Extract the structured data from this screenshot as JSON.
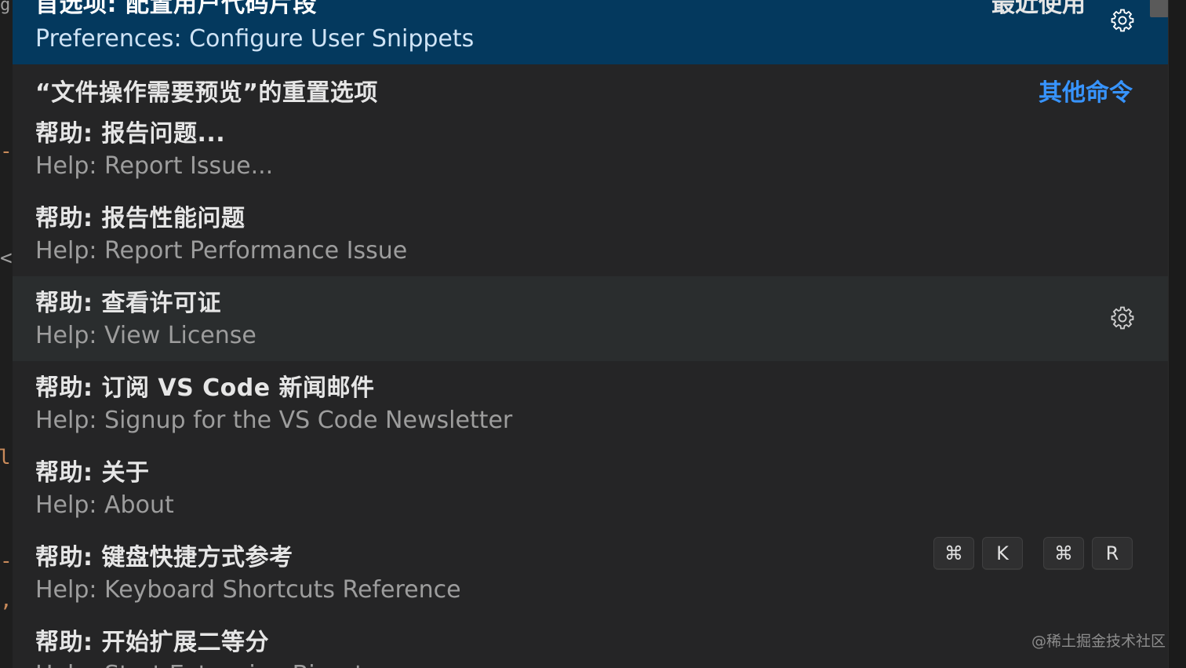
{
  "items": [
    {
      "primary": "首选项: 配置用户代码片段",
      "secondary": "Preferences: Configure User Snippets",
      "group": "最近使用"
    },
    {
      "primary": "“文件操作需要预览”的重置选项",
      "group": "其他命令"
    },
    {
      "primary": "帮助: 报告问题...",
      "secondary": "Help: Report Issue..."
    },
    {
      "primary": "帮助: 报告性能问题",
      "secondary": "Help: Report Performance Issue"
    },
    {
      "primary": "帮助: 查看许可证",
      "secondary": "Help: View License"
    },
    {
      "primary": "帮助: 订阅 VS Code 新闻邮件",
      "secondary": "Help: Signup for the VS Code Newsletter"
    },
    {
      "primary": "帮助: 关于",
      "secondary": "Help: About"
    },
    {
      "primary": "帮助: 键盘快捷方式参考",
      "secondary": "Help: Keyboard Shortcuts Reference",
      "keybinding": [
        "⌘",
        "K",
        "⌘",
        "R"
      ]
    },
    {
      "primary": "帮助: 开始扩展二等分",
      "secondary": "Help: Start Extension Bisect"
    }
  ],
  "watermark": "@稀土掘金技术社区",
  "colors": {
    "selected_bg": "#04395e",
    "hover_bg": "#2a2d2e",
    "list_bg": "#252526",
    "link": "#3794ff"
  },
  "icons": {
    "configure": "gear-icon"
  }
}
